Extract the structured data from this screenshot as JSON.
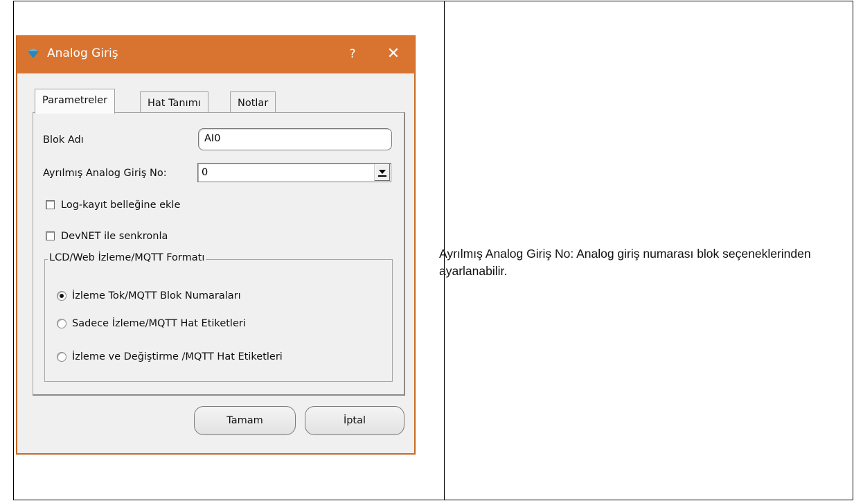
{
  "dialog": {
    "title": "Analog Giriş",
    "help": "?",
    "close": "✕",
    "tabs": [
      "Parametreler",
      "Hat Tanımı",
      "Notlar"
    ],
    "block_name_label": "Blok Adı",
    "block_name_value": "AI0",
    "reserved_label": "Ayrılmış Analog Giriş No:",
    "reserved_value": "0",
    "log_checkbox_label": "Log-kayıt belleğine ekle",
    "log_checked": false,
    "devnet_checkbox_label": "DevNET ile senkronla",
    "devnet_checked": false,
    "group_title": "LCD/Web İzleme/MQTT Formatı",
    "radio_options": [
      "İzleme Tok/MQTT Blok Numaraları",
      "Sadece İzleme/MQTT Hat Etiketleri",
      "İzleme ve Değiştirme /MQTT Hat Etiketleri"
    ],
    "radio_selected": 0,
    "ok_label": "Tamam",
    "cancel_label": "İptal",
    "colors": {
      "titlebar": "#d97430",
      "background": "#f0f0f0"
    }
  },
  "description": "Ayrılmış Analog Giriş No:  Analog giriş numarası blok seçeneklerinden ayarlanabilir."
}
